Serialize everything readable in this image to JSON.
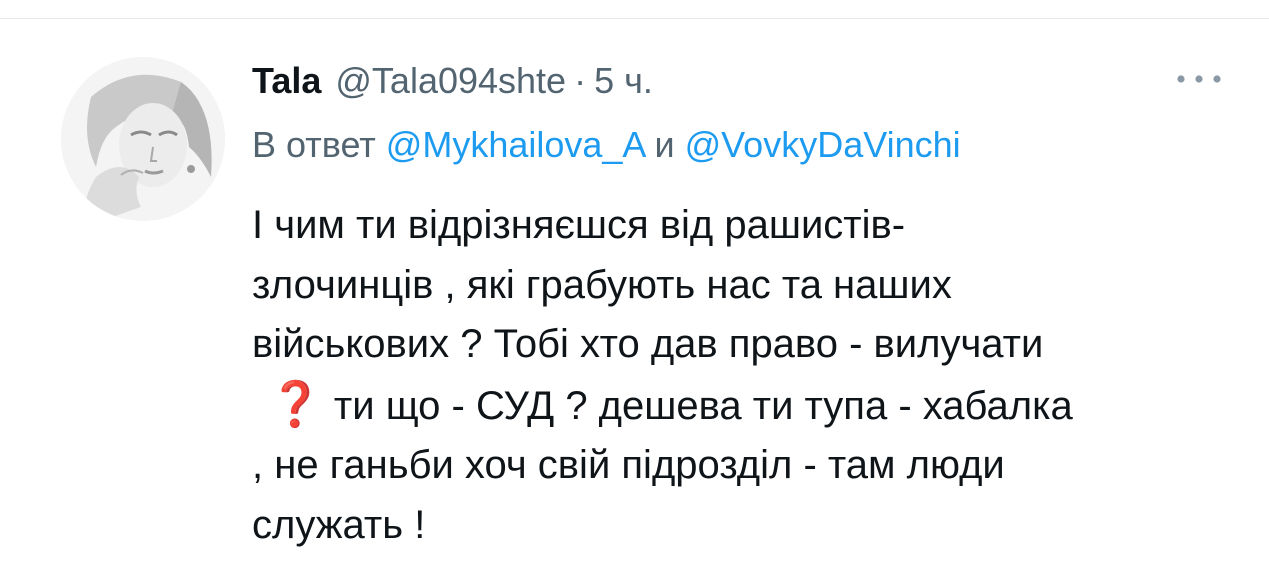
{
  "tweet": {
    "author": {
      "name": "Tala",
      "handle": "@Tala094shte",
      "separator": "·",
      "time": "5 ч."
    },
    "more_icon": "more-dots-icon",
    "reply": {
      "prefix": "В ответ",
      "mention_1": "@Mykhailova_A",
      "conjunction": "и",
      "mention_2": "@VovkyDaVinchi"
    },
    "text": {
      "part_1": "І чим ти відрізняєшся від рашистів-\nзлочинців  , які грабують нас та наших\nвійськових ? Тобі хто дав право - вилучати\n",
      "question_emoji": "❓",
      "part_2": " ти що - СУД ?  дешева ти тупа - хабалка\n, не ганьби хоч свій підрозділ - там люди\nслужать !"
    }
  },
  "colors": {
    "text": "#0f1419",
    "secondary": "#536471",
    "link": "#1d9bf0",
    "emoji_red": "#dd2e44",
    "divider": "#e6e8ea"
  }
}
